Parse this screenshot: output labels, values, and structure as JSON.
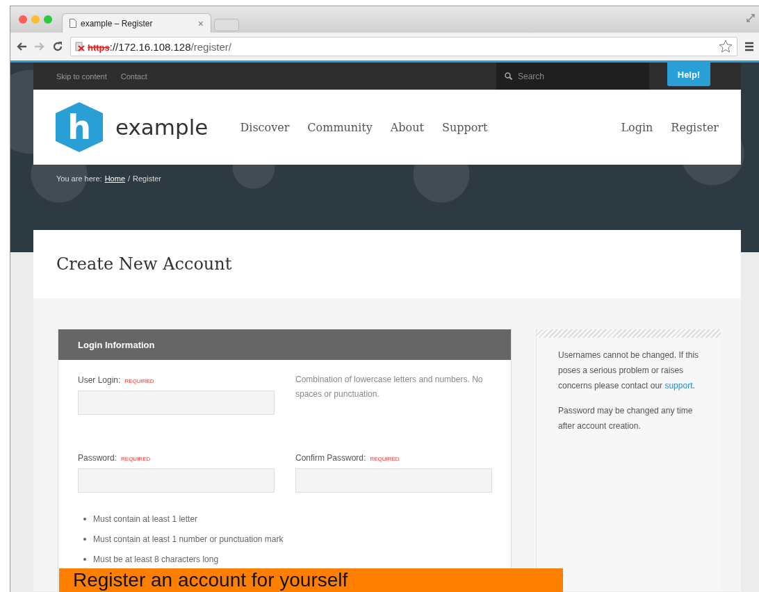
{
  "browser": {
    "tab_title": "example – Register",
    "tab_close": "×",
    "url_scheme": "https",
    "url_host": "://172.16.108.128",
    "url_path": "/register/"
  },
  "topbar": {
    "links": [
      "Skip to content",
      "Contact"
    ],
    "search_placeholder": "Search",
    "help_button": "Help!"
  },
  "header": {
    "logo_letter": "h",
    "logo_text": "example",
    "nav": [
      "Discover",
      "Community",
      "About",
      "Support"
    ],
    "account_links": [
      "Login",
      "Register"
    ]
  },
  "breadcrumb": {
    "prefix": "You are here:",
    "home": "Home",
    "separator": "/",
    "current": "Register"
  },
  "page_title": "Create New Account",
  "form": {
    "section_title": "Login Information",
    "fields": [
      {
        "label": "User Login:",
        "required": "REQUIRED"
      },
      {
        "label": "Password:",
        "required": "REQUIRED"
      },
      {
        "label": "Confirm Password:",
        "required": "REQUIRED"
      }
    ],
    "login_hint": "Combination of lowercase letters and numbers. No spaces or punctuation.",
    "password_rules": [
      "Must contain at least 1 letter",
      "Must contain at least 1 number or punctuation mark",
      "Must be at least 8 characters long"
    ]
  },
  "sidebar": {
    "note_before_link": "Usernames cannot be changed. If this poses a serious problem or raises concerns please contact our",
    "link": "support",
    "note_after_link": ".",
    "note_2": "Password may be changed any time after account creation."
  },
  "caption": "Register an account for yourself"
}
